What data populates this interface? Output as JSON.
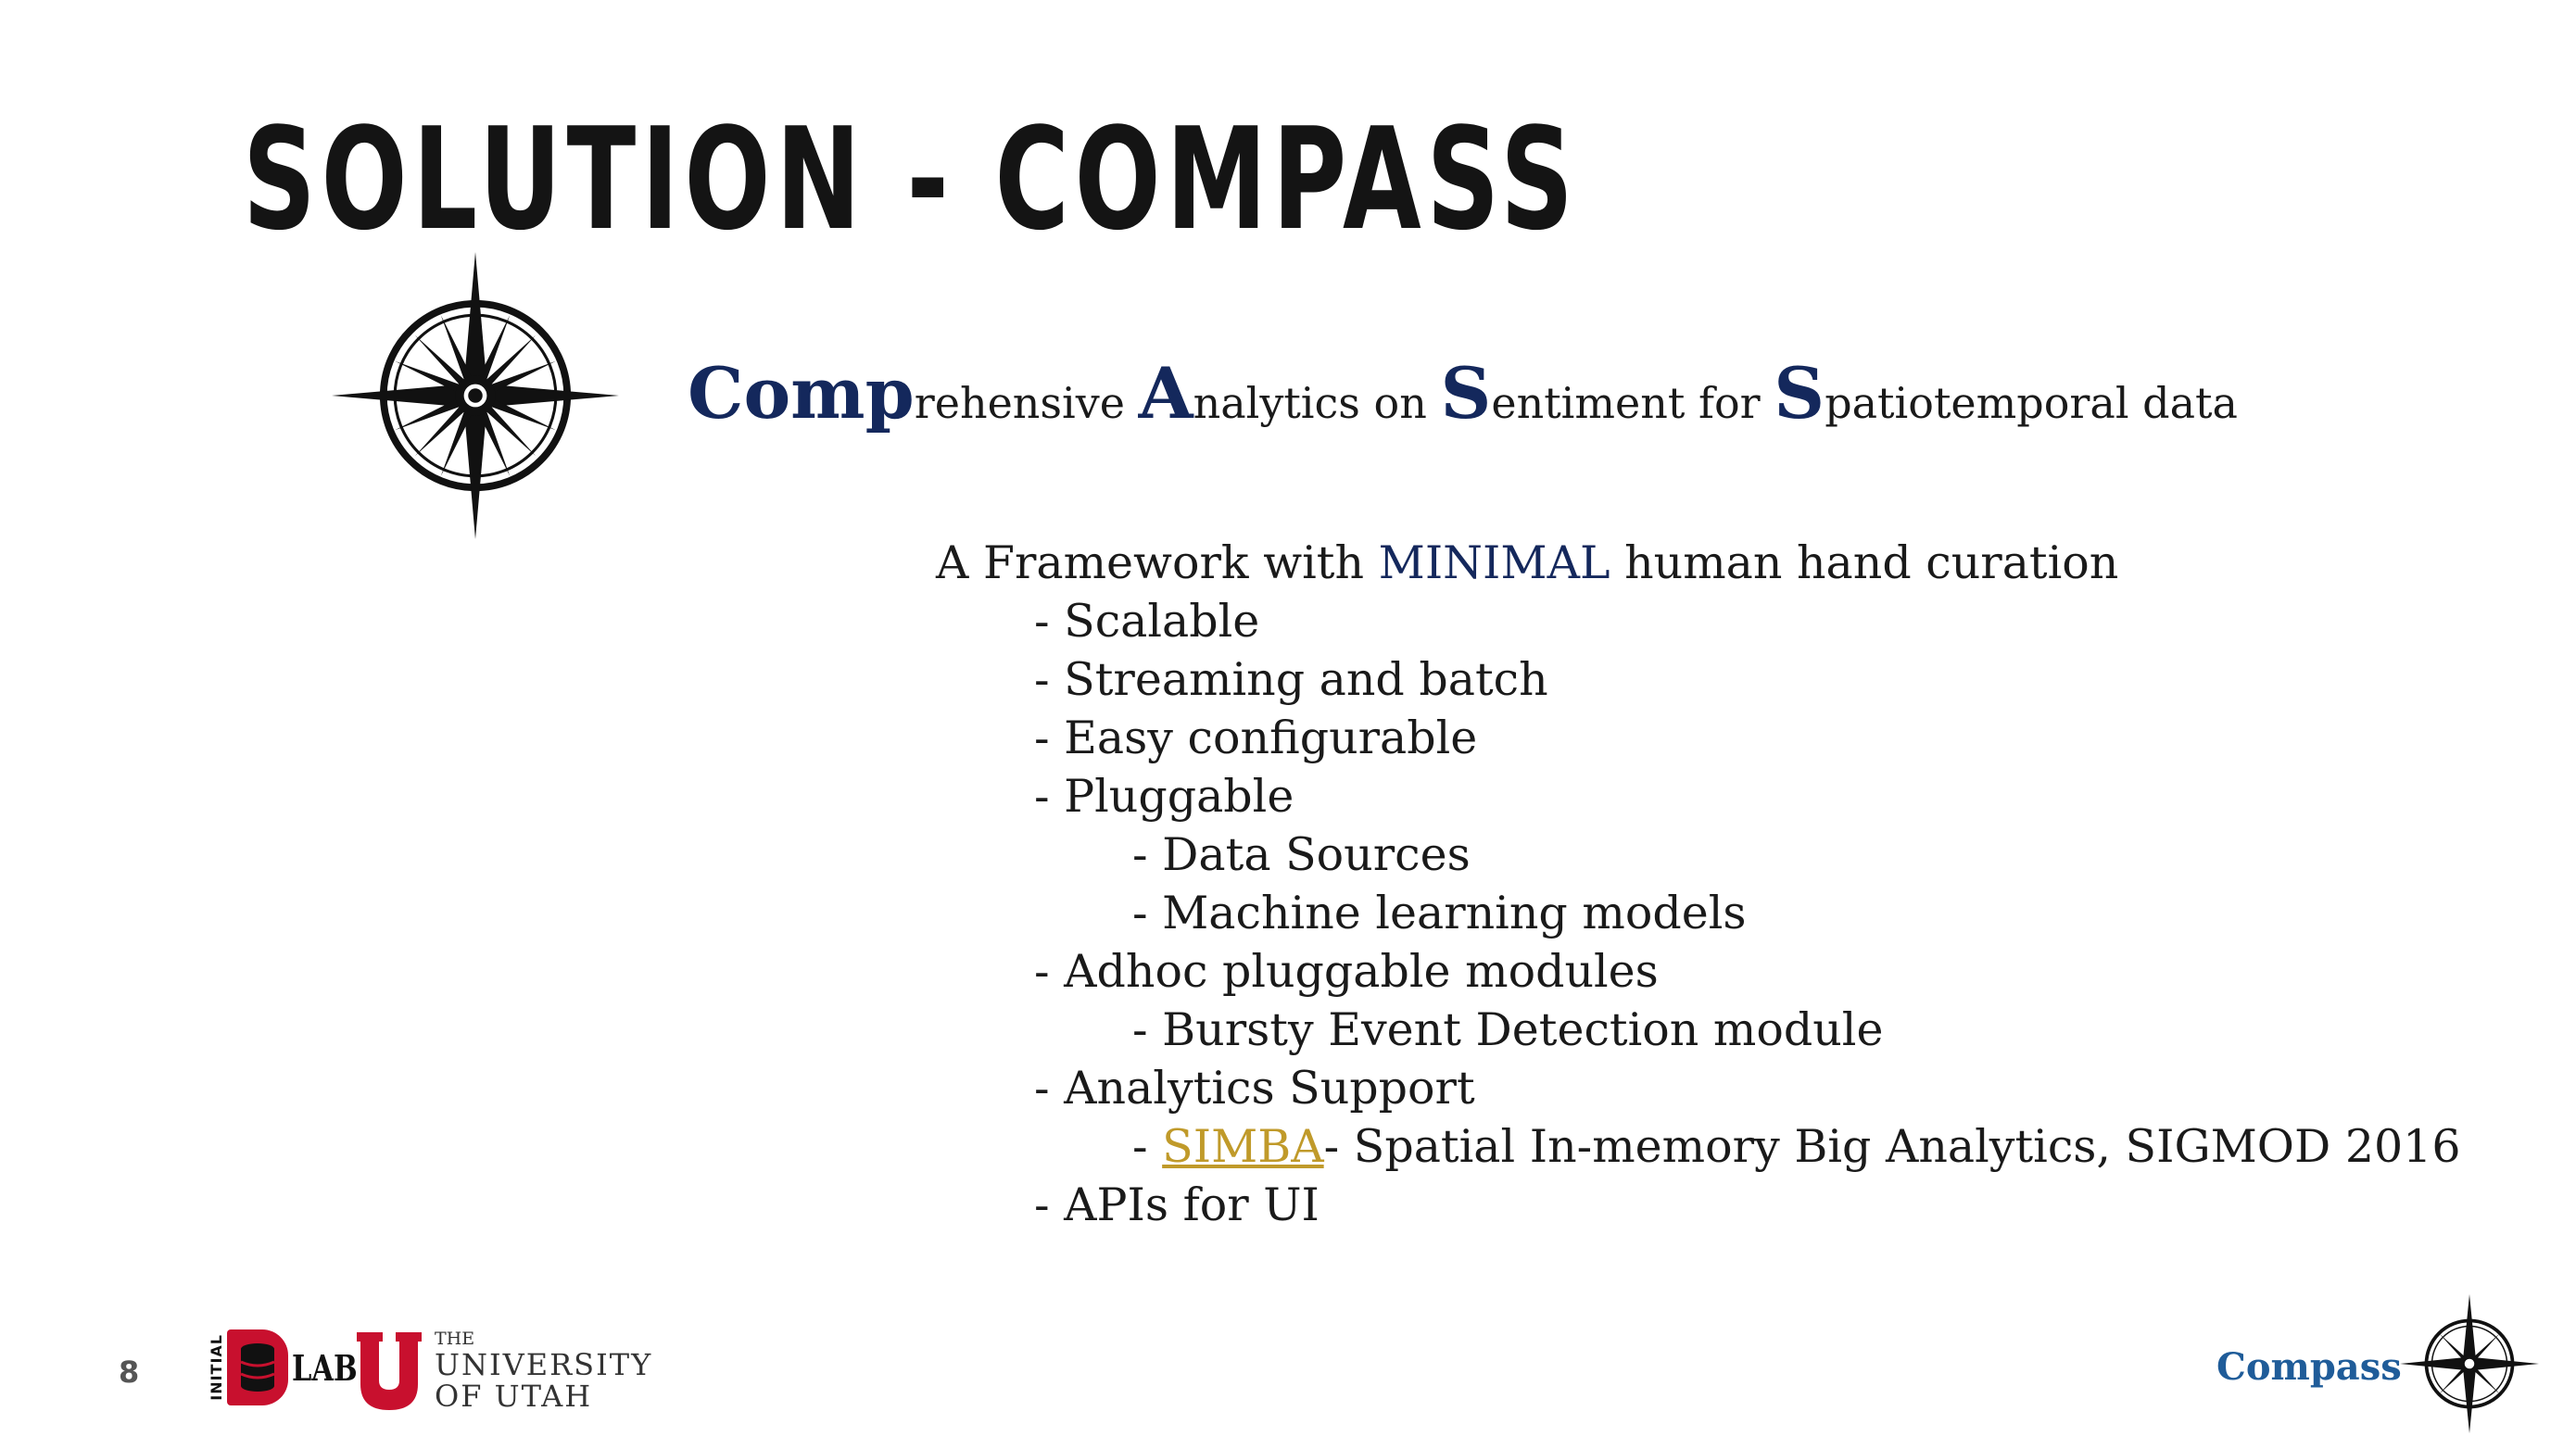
{
  "slide": {
    "title": "SOLUTION - COMPASS",
    "subtitle": {
      "cap1": "Comp",
      "rest1": "rehensive ",
      "cap2": "A",
      "rest2": "nalytics on ",
      "cap3": "S",
      "rest3": "entiment for ",
      "cap4": "S",
      "rest4": "patiotemporal data"
    },
    "intro": {
      "before": "A Framework with ",
      "highlight": "MINIMAL",
      "after": " human hand curation"
    },
    "items": [
      "- Scalable",
      "- Streaming and batch",
      "- Easy configurable",
      "- Pluggable",
      "- Data Sources",
      "- Machine learning models",
      "- Adhoc pluggable modules",
      "- Bursty Event Detection module",
      "- Analytics Support",
      "- ",
      "- APIs for UI"
    ],
    "simba": {
      "link": "SIMBA",
      "rest": "- Spatial In-memory Big Analytics, SIGMOD 2016"
    },
    "colors": {
      "accent_blue": "#14285c",
      "link_gold": "#c09a2a",
      "footer_blue": "#1f5c99",
      "utah_red": "#c8102e"
    }
  },
  "footer": {
    "page_number": "8",
    "dlab": {
      "initial": "INITIAL",
      "lab": "LAB"
    },
    "university": {
      "the": "THE",
      "univ": "UNIVERSITY",
      "utah": "OF UTAH"
    },
    "brand": "Compass",
    "icons": [
      "compass-rose-icon",
      "database-icon",
      "block-u-icon"
    ]
  }
}
